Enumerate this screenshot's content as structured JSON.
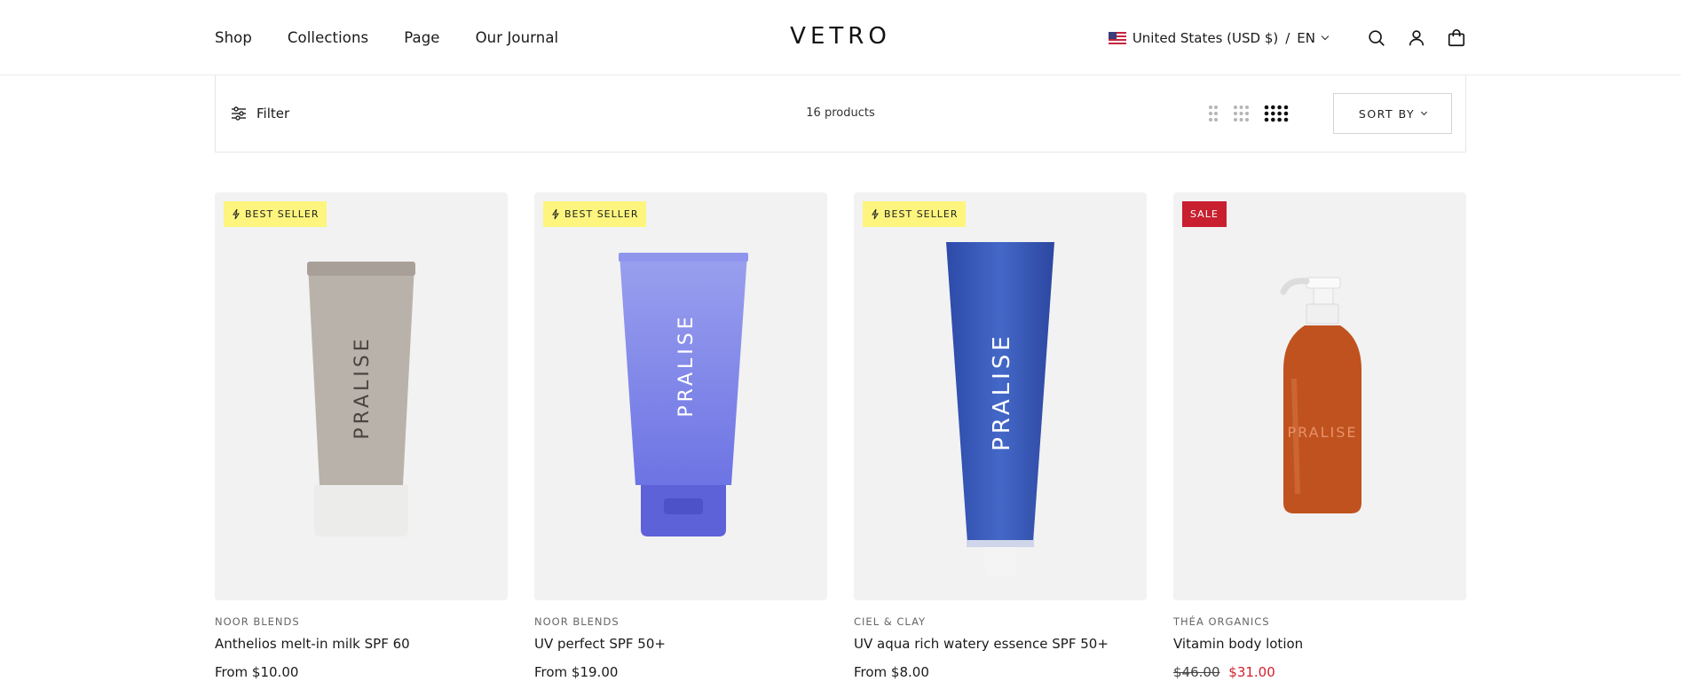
{
  "header": {
    "nav": [
      "Shop",
      "Collections",
      "Page",
      "Our Journal"
    ],
    "logo": "VETRO",
    "locale": {
      "country": "United States (USD $)",
      "separator": "/",
      "language": "EN"
    },
    "icons": [
      "search-icon",
      "account-icon",
      "cart-icon"
    ]
  },
  "toolbar": {
    "filter_label": "Filter",
    "product_count": "16 products",
    "sort_label": "SORT BY",
    "grid_options": [
      "grid-2-icon",
      "grid-3-icon",
      "grid-4-icon"
    ],
    "selected_grid": "grid-4-icon"
  },
  "products": [
    {
      "badge": "BEST SELLER",
      "badge_type": "best",
      "vendor": "NOOR BLENDS",
      "title": "Anthelios melt-in milk SPF 60",
      "price": "From $10.00",
      "product_label": "PRALISE",
      "color": "#b9b2aa"
    },
    {
      "badge": "BEST SELLER",
      "badge_type": "best",
      "vendor": "NOOR BLENDS",
      "title": "UV perfect SPF 50+",
      "price": "From $19.00",
      "product_label": "PRALISE",
      "color": "#7e86ea"
    },
    {
      "badge": "BEST SELLER",
      "badge_type": "best",
      "vendor": "CIEL & CLAY",
      "title": "UV aqua rich watery essence SPF 50+",
      "price": "From $8.00",
      "product_label": "PRALISE",
      "color": "#3c5bb8"
    },
    {
      "badge": "SALE",
      "badge_type": "sale",
      "vendor": "THÉA ORGANICS",
      "title": "Vitamin body lotion",
      "compare_price": "$46.00",
      "sale_price": "$31.00",
      "product_label": "PRALISE",
      "color": "#c0521f"
    }
  ],
  "colors": {
    "badge_best": "#fdf57e",
    "badge_sale": "#c8202f",
    "sale_price": "#d3202e"
  }
}
